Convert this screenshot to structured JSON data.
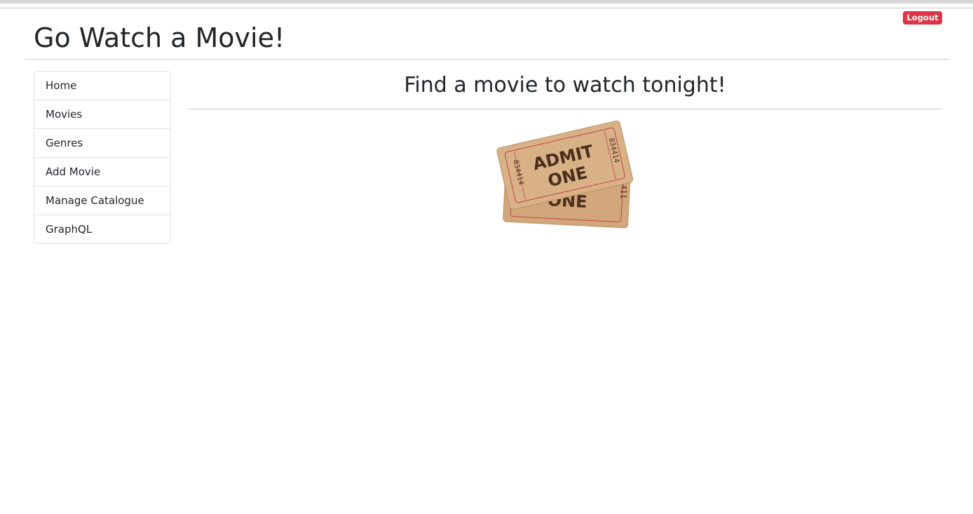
{
  "header": {
    "title": "Go Watch a Movie!",
    "logout_label": "Logout"
  },
  "sidebar": {
    "items": [
      {
        "label": "Home"
      },
      {
        "label": "Movies"
      },
      {
        "label": "Genres"
      },
      {
        "label": "Add Movie"
      },
      {
        "label": "Manage Catalogue"
      },
      {
        "label": "GraphQL"
      }
    ]
  },
  "main": {
    "heading": "Find a movie to watch tonight!",
    "image": {
      "icon": "movie-tickets-icon",
      "ticket_text_line1": "ADMIT",
      "ticket_text_line2": "ONE",
      "ticket_number": "834414",
      "back_ticket_text": "ONE",
      "back_ticket_number": "4411"
    }
  },
  "colors": {
    "logout_bg": "#dc3545",
    "text": "#212529",
    "border": "#dee2e6",
    "ticket_paper": "#d6ad82",
    "ticket_ink": "#4a2f1c",
    "ticket_border_line": "#c0444c"
  }
}
